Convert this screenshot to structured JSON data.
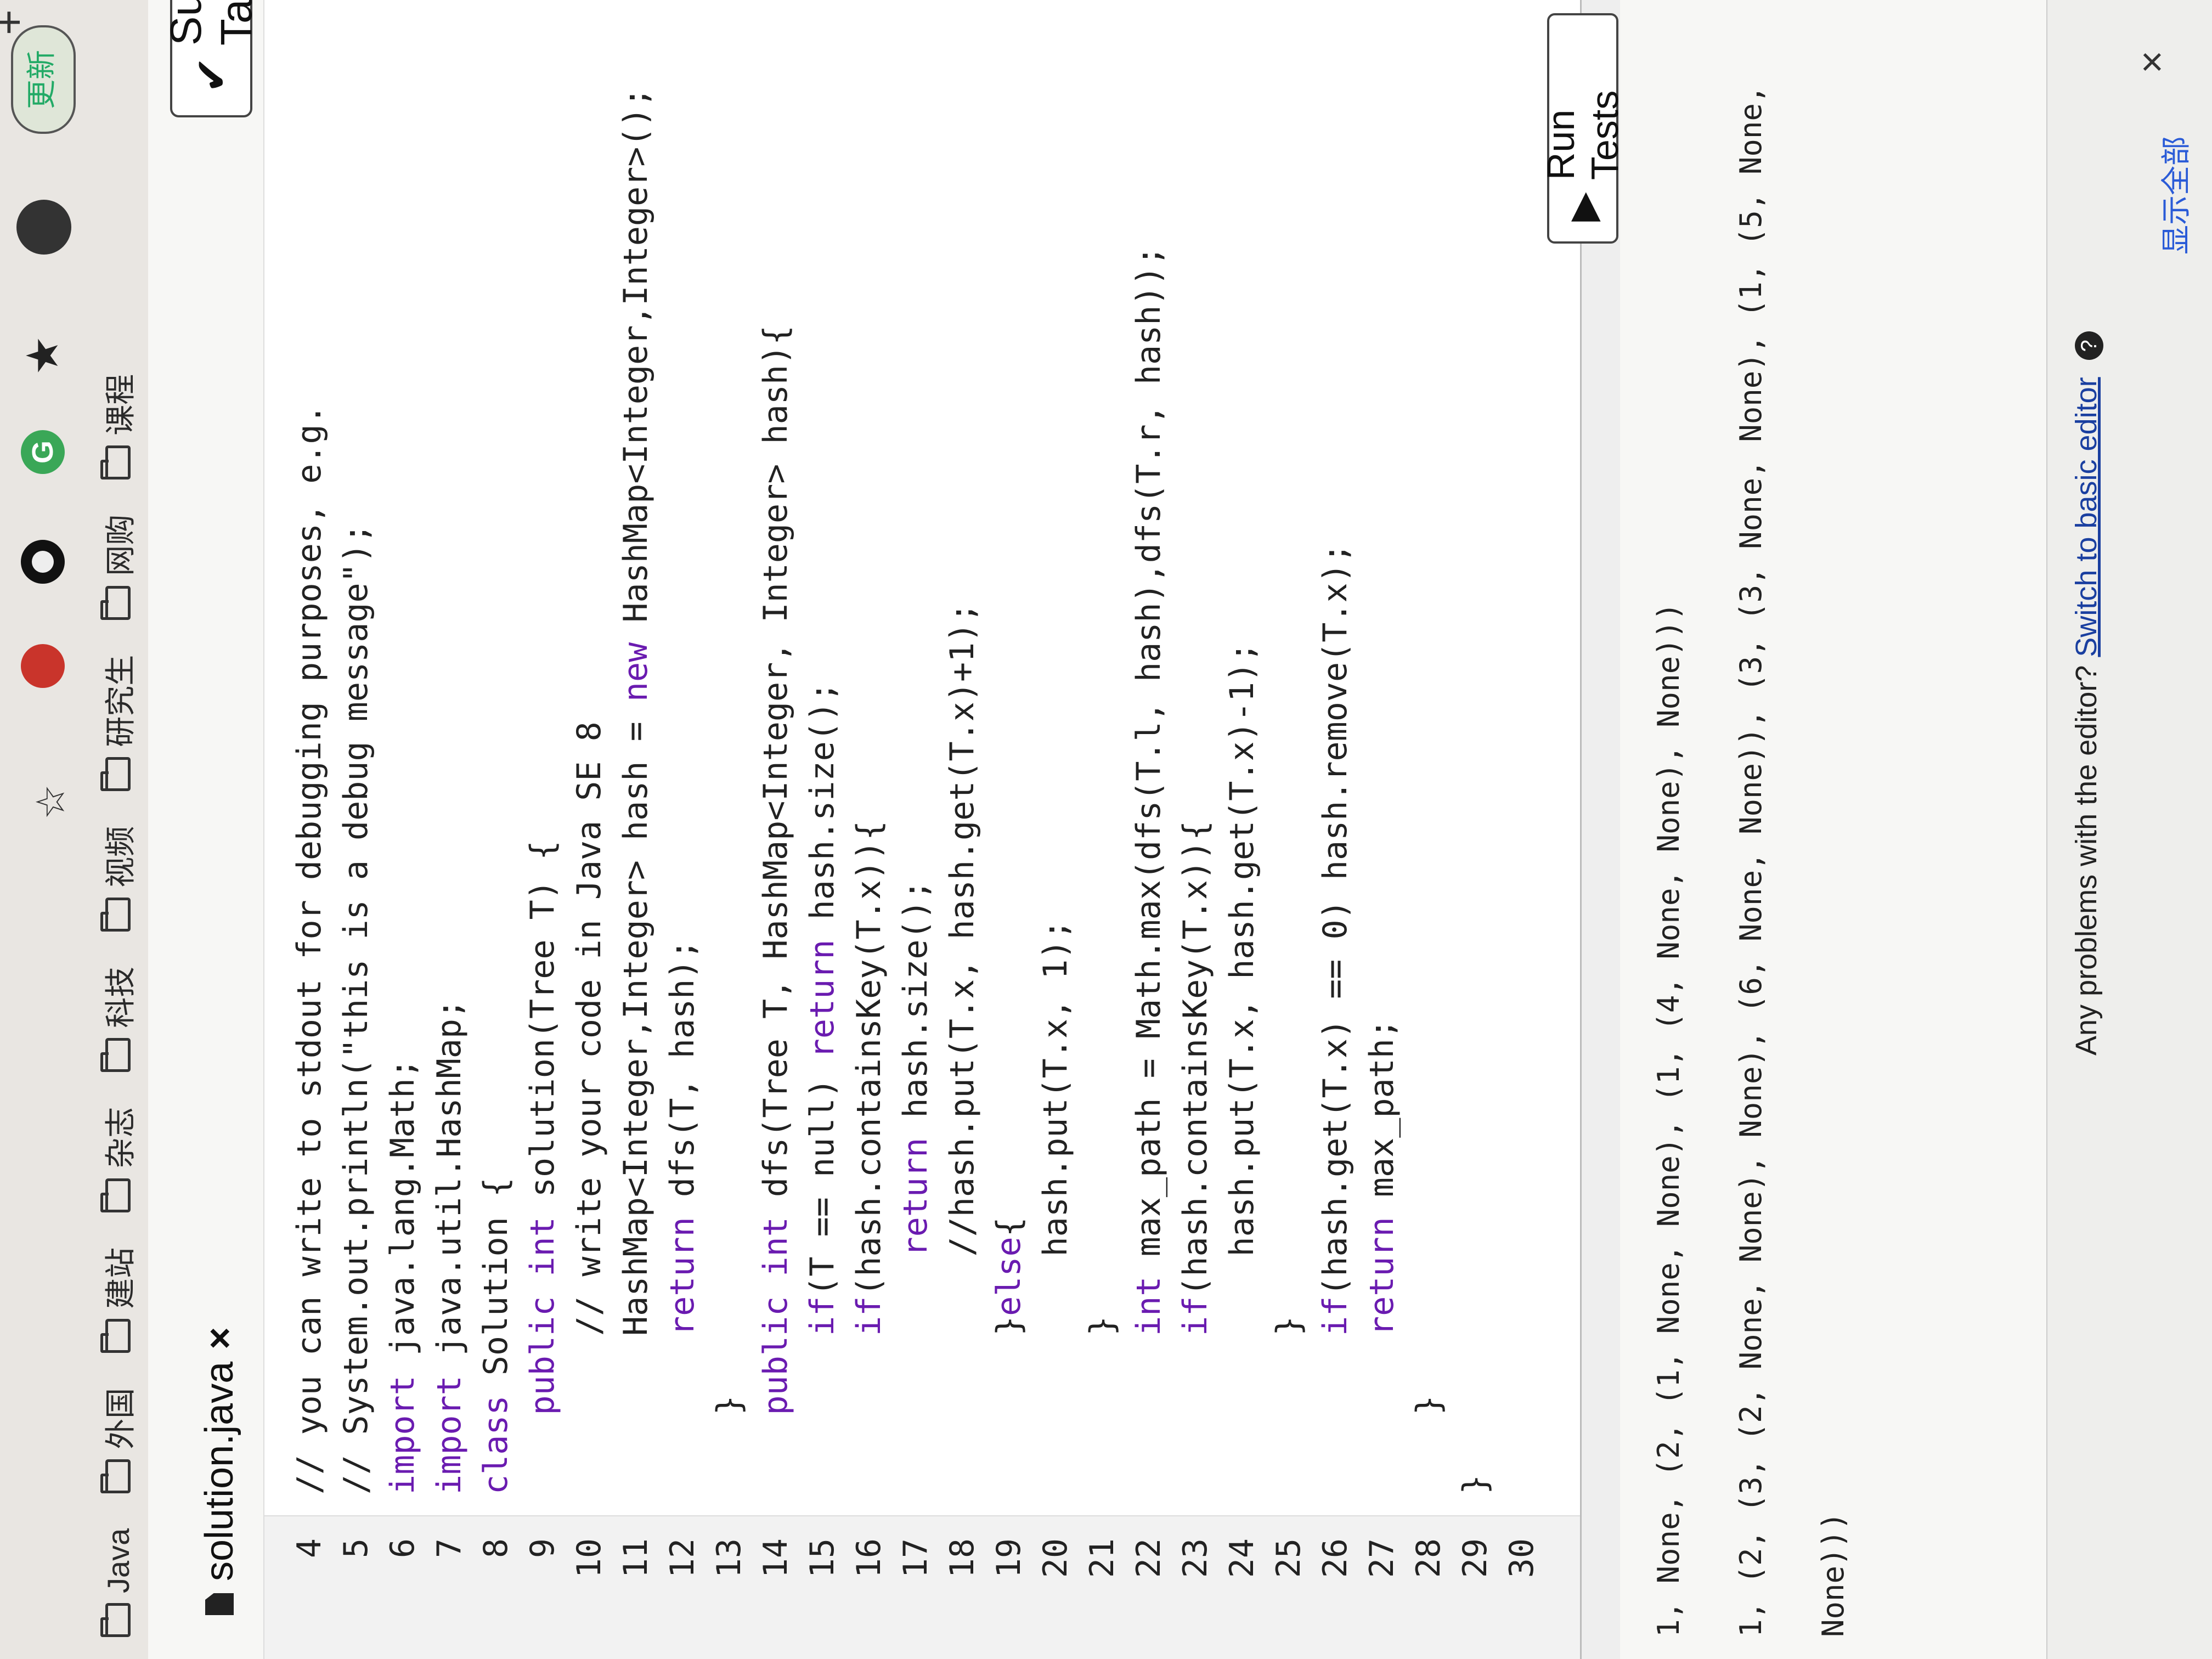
{
  "browser": {
    "bookmarks": [
      "Java",
      "外国",
      "建站",
      "杂志",
      "科技",
      "视频",
      "研究生",
      "网购",
      "课程"
    ],
    "update_label": "更新",
    "ext_g_label": "G"
  },
  "tab": {
    "filename": "solution.java",
    "close": "×"
  },
  "actions": {
    "submit_label": "Submit Tas",
    "run_label": "Run Tests"
  },
  "code": [
    {
      "n": "4",
      "t": "// you can write to stdout for debugging purposes, e.g."
    },
    {
      "n": "5",
      "t": "// System.out.println(\"this is a debug message\");"
    },
    {
      "n": "6",
      "t": "import java.lang.Math;"
    },
    {
      "n": "7",
      "t": "import java.util.HashMap;"
    },
    {
      "n": "8",
      "t": "class Solution {"
    },
    {
      "n": "9",
      "t": "    public int solution(Tree T) {"
    },
    {
      "n": "10",
      "t": "        // write your code in Java SE 8"
    },
    {
      "n": "11",
      "t": "        HashMap<Integer,Integer> hash = new HashMap<Integer,Integer>();"
    },
    {
      "n": "12",
      "t": "        return dfs(T, hash);"
    },
    {
      "n": "13",
      "t": "    }"
    },
    {
      "n": "14",
      "t": "    public int dfs(Tree T, HashMap<Integer, Integer> hash){"
    },
    {
      "n": "15",
      "t": "        if(T == null) return hash.size();"
    },
    {
      "n": "16",
      "t": "        if(hash.containsKey(T.x)){"
    },
    {
      "n": "17",
      "t": "            return hash.size();"
    },
    {
      "n": "18",
      "t": "            //hash.put(T.x, hash.get(T.x)+1);"
    },
    {
      "n": "19",
      "t": "        }else{"
    },
    {
      "n": "20",
      "t": "            hash.put(T.x, 1);"
    },
    {
      "n": "21",
      "t": "        }"
    },
    {
      "n": "22",
      "t": "        int max_path = Math.max(dfs(T.l, hash),dfs(T.r, hash));"
    },
    {
      "n": "23",
      "t": "        if(hash.containsKey(T.x)){"
    },
    {
      "n": "24",
      "t": "            hash.put(T.x, hash.get(T.x)-1);"
    },
    {
      "n": "25",
      "t": "        }"
    },
    {
      "n": "26",
      "t": "        if(hash.get(T.x) == 0) hash.remove(T.x);"
    },
    {
      "n": "27",
      "t": "        return max_path;"
    },
    {
      "n": "28",
      "t": "    }"
    },
    {
      "n": "29",
      "t": "}"
    },
    {
      "n": "30",
      "t": ""
    }
  ],
  "tests": [
    "1, None, (2, (1, None, None), (1, (4, None, None), None)))",
    "1, (2, (3, (2, None, None), None), (6, None, None)), (3, (3, None, None), (1, (5, None,",
    "None)))"
  ],
  "footer": {
    "problems_text": "Any problems with the editor?",
    "switch_link": "Switch to basic editor",
    "help": "?",
    "show_all": "显示全部",
    "close": "×"
  }
}
